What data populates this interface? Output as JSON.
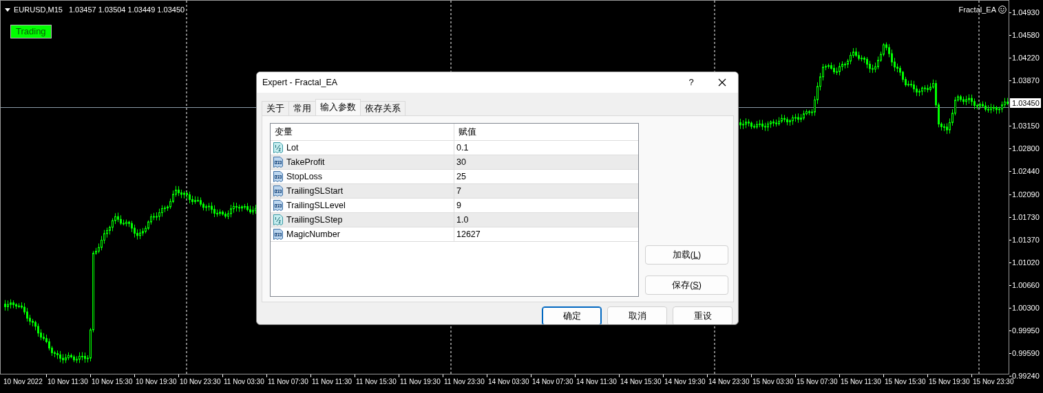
{
  "chart": {
    "symbol": "EURUSD,M15",
    "ohlc": "1.03457 1.03504 1.03449 1.03450",
    "status_badge": "Trading",
    "expert": "Fractal_EA",
    "price_axis": [
      {
        "text": "1.04930",
        "kind": "tick"
      },
      {
        "text": "1.04580",
        "kind": "tick"
      },
      {
        "text": "1.04220",
        "kind": "tick"
      },
      {
        "text": "1.03870",
        "kind": "tick"
      },
      {
        "text": "1.03450",
        "kind": "current"
      },
      {
        "text": "1.03150",
        "kind": "tick"
      },
      {
        "text": "1.02800",
        "kind": "tick"
      },
      {
        "text": "1.02440",
        "kind": "tick"
      },
      {
        "text": "1.02090",
        "kind": "tick"
      },
      {
        "text": "1.01730",
        "kind": "tick"
      },
      {
        "text": "1.01370",
        "kind": "tick"
      },
      {
        "text": "1.01020",
        "kind": "tick"
      },
      {
        "text": "1.00660",
        "kind": "tick"
      },
      {
        "text": "1.00300",
        "kind": "tick"
      },
      {
        "text": "0.99950",
        "kind": "tick"
      },
      {
        "text": "0.99590",
        "kind": "tick"
      },
      {
        "text": "0.99240",
        "kind": "tick"
      }
    ],
    "time_axis": [
      "10 Nov 2022",
      "10 Nov 11:30",
      "10 Nov 15:30",
      "10 Nov 19:30",
      "10 Nov 23:30",
      "11 Nov 03:30",
      "11 Nov 07:30",
      "11 Nov 11:30",
      "11 Nov 15:30",
      "11 Nov 19:30",
      "11 Nov 23:30",
      "14 Nov 03:30",
      "14 Nov 07:30",
      "14 Nov 11:30",
      "14 Nov 15:30",
      "14 Nov 19:30",
      "14 Nov 23:30",
      "15 Nov 03:30",
      "15 Nov 07:30",
      "15 Nov 11:30",
      "15 Nov 15:30",
      "15 Nov 19:30",
      "15 Nov 23:30"
    ]
  },
  "dialog": {
    "title": "Expert - Fractal_EA",
    "help_button": "?",
    "tabs": [
      {
        "label": "关于",
        "selected": false
      },
      {
        "label": "常用",
        "selected": false
      },
      {
        "label": "输入参数",
        "selected": true
      },
      {
        "label": "依存关系",
        "selected": false
      }
    ],
    "columns": [
      "变量",
      "赋值"
    ],
    "rows": [
      {
        "name": "Lot",
        "value": "0.1",
        "kind": "double"
      },
      {
        "name": "TakeProfit",
        "value": "30",
        "kind": "int"
      },
      {
        "name": "StopLoss",
        "value": "25",
        "kind": "int"
      },
      {
        "name": "TrailingSLStart",
        "value": "7",
        "kind": "int"
      },
      {
        "name": "TrailingSLLevel",
        "value": "9",
        "kind": "int"
      },
      {
        "name": "TrailingSLStep",
        "value": "1.0",
        "kind": "double"
      },
      {
        "name": "MagicNumber",
        "value": "12627",
        "kind": "int"
      }
    ],
    "side_buttons": [
      "加载(L)",
      "保存(S)"
    ],
    "buttons": [
      {
        "label": "确定",
        "default": true
      },
      {
        "label": "取消",
        "default": false
      },
      {
        "label": "重设",
        "default": false
      }
    ]
  }
}
